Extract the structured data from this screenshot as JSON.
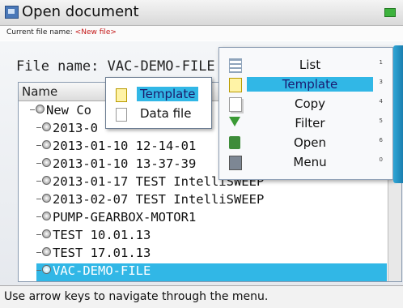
{
  "window": {
    "title": "Open document"
  },
  "subheader": {
    "label": "Current file name:",
    "value": "<New file>"
  },
  "file_name": {
    "label": "File name:",
    "value": "VAC-DEMO-FILE"
  },
  "tree": {
    "header": "Name",
    "items": [
      "New Co",
      "2013-0",
      "2013-01-10 12-14-01",
      "2013-01-10 13-37-39",
      "2013-01-17 TEST IntelliSWEEP",
      "2013-02-07 TEST IntelliSWEEP",
      "PUMP-GEARBOX-MOTOR1",
      "TEST 10.01.13",
      "TEST 17.01.13",
      "VAC-DEMO-FILE"
    ],
    "selected": "VAC-DEMO-FILE"
  },
  "popup": {
    "items": [
      "Template",
      "Data file"
    ],
    "selected": "Template"
  },
  "context_menu": {
    "items": [
      {
        "label": "List",
        "key": "1",
        "icon": "list-icon"
      },
      {
        "label": "Template",
        "key": "3",
        "icon": "template-icon"
      },
      {
        "label": "Copy",
        "key": "4",
        "icon": "copy-icon"
      },
      {
        "label": "Filter",
        "key": "5",
        "icon": "filter-icon"
      },
      {
        "label": "Open",
        "key": "6",
        "icon": "open-icon"
      },
      {
        "label": "Menu",
        "key": "0",
        "icon": "menu-icon"
      }
    ],
    "selected": "Template"
  },
  "statusbar": {
    "text": "Use arrow keys to navigate through the menu."
  },
  "colors": {
    "selection": "#31b7e6",
    "accent": "#1b7fb0"
  }
}
